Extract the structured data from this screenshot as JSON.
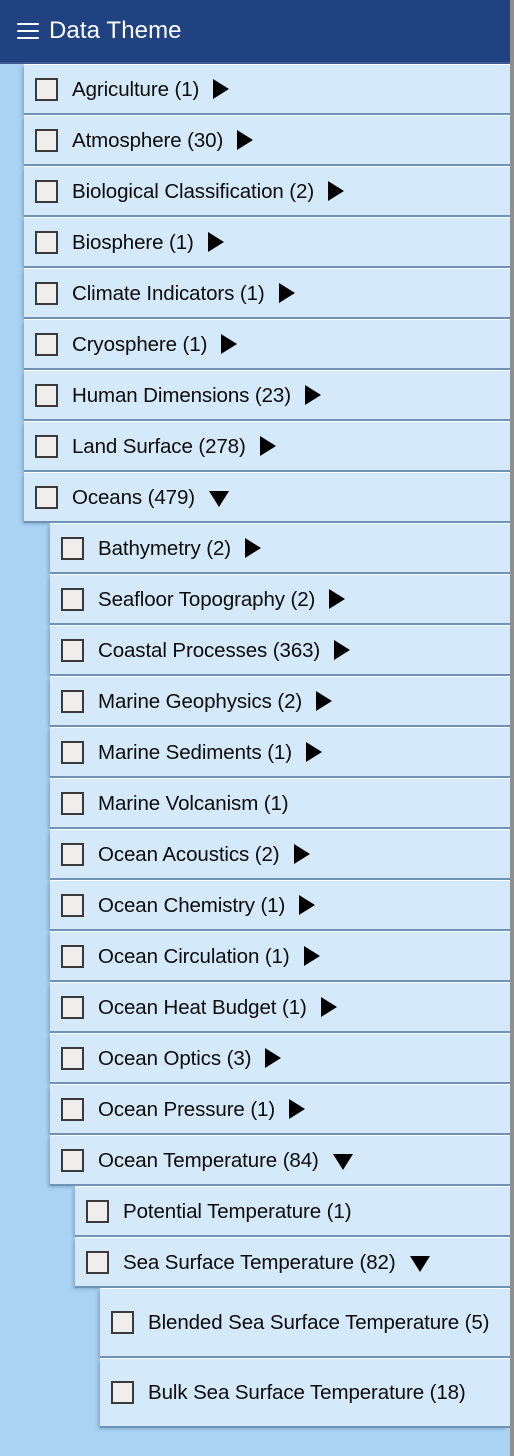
{
  "header": {
    "title": "Data Theme",
    "menu_icon": "hamburger-icon",
    "background_color": "#204281",
    "text_color": "#ffffff"
  },
  "colors": {
    "panel_background": "#a9d2f3",
    "row_background": "#d4e9fa",
    "row_divider": "#6f93b4",
    "checkbox_border": "#3a3a3a",
    "checkbox_fill": "#efeeec",
    "arrow": "#000000"
  },
  "tree": {
    "items": [
      {
        "label": "Agriculture (1)",
        "name": "Agriculture",
        "count": 1,
        "level": 0,
        "arrow": "collapsed",
        "checked": false
      },
      {
        "label": "Atmosphere (30)",
        "name": "Atmosphere",
        "count": 30,
        "level": 0,
        "arrow": "collapsed",
        "checked": false
      },
      {
        "label": "Biological Classification (2)",
        "name": "Biological Classification",
        "count": 2,
        "level": 0,
        "arrow": "collapsed",
        "checked": false
      },
      {
        "label": "Biosphere (1)",
        "name": "Biosphere",
        "count": 1,
        "level": 0,
        "arrow": "collapsed",
        "checked": false
      },
      {
        "label": "Climate Indicators (1)",
        "name": "Climate Indicators",
        "count": 1,
        "level": 0,
        "arrow": "collapsed",
        "checked": false
      },
      {
        "label": "Cryosphere (1)",
        "name": "Cryosphere",
        "count": 1,
        "level": 0,
        "arrow": "collapsed",
        "checked": false
      },
      {
        "label": "Human Dimensions (23)",
        "name": "Human Dimensions",
        "count": 23,
        "level": 0,
        "arrow": "collapsed",
        "checked": false
      },
      {
        "label": "Land Surface (278)",
        "name": "Land Surface",
        "count": 278,
        "level": 0,
        "arrow": "collapsed",
        "checked": false
      },
      {
        "label": "Oceans (479)",
        "name": "Oceans",
        "count": 479,
        "level": 0,
        "arrow": "expanded",
        "checked": false
      },
      {
        "label": "Bathymetry (2)",
        "name": "Bathymetry",
        "count": 2,
        "level": 1,
        "arrow": "collapsed",
        "checked": false
      },
      {
        "label": "Seafloor Topography (2)",
        "name": "Seafloor Topography",
        "count": 2,
        "level": 1,
        "arrow": "collapsed",
        "checked": false
      },
      {
        "label": "Coastal Processes (363)",
        "name": "Coastal Processes",
        "count": 363,
        "level": 1,
        "arrow": "collapsed",
        "checked": false
      },
      {
        "label": "Marine Geophysics (2)",
        "name": "Marine Geophysics",
        "count": 2,
        "level": 1,
        "arrow": "collapsed",
        "checked": false
      },
      {
        "label": "Marine Sediments (1)",
        "name": "Marine Sediments",
        "count": 1,
        "level": 1,
        "arrow": "collapsed",
        "checked": false
      },
      {
        "label": "Marine Volcanism (1)",
        "name": "Marine Volcanism",
        "count": 1,
        "level": 1,
        "arrow": "none",
        "checked": false
      },
      {
        "label": "Ocean Acoustics (2)",
        "name": "Ocean Acoustics",
        "count": 2,
        "level": 1,
        "arrow": "collapsed",
        "checked": false
      },
      {
        "label": "Ocean Chemistry (1)",
        "name": "Ocean Chemistry",
        "count": 1,
        "level": 1,
        "arrow": "collapsed",
        "checked": false
      },
      {
        "label": "Ocean Circulation (1)",
        "name": "Ocean Circulation",
        "count": 1,
        "level": 1,
        "arrow": "collapsed",
        "checked": false
      },
      {
        "label": "Ocean Heat Budget (1)",
        "name": "Ocean Heat Budget",
        "count": 1,
        "level": 1,
        "arrow": "collapsed",
        "checked": false
      },
      {
        "label": "Ocean Optics (3)",
        "name": "Ocean Optics",
        "count": 3,
        "level": 1,
        "arrow": "collapsed",
        "checked": false
      },
      {
        "label": "Ocean Pressure (1)",
        "name": "Ocean Pressure",
        "count": 1,
        "level": 1,
        "arrow": "collapsed",
        "checked": false
      },
      {
        "label": "Ocean Temperature (84)",
        "name": "Ocean Temperature",
        "count": 84,
        "level": 1,
        "arrow": "expanded",
        "checked": false
      },
      {
        "label": "Potential Temperature (1)",
        "name": "Potential Temperature",
        "count": 1,
        "level": 2,
        "arrow": "none",
        "checked": false
      },
      {
        "label": "Sea Surface Temperature (82)",
        "name": "Sea Surface Temperature",
        "count": 82,
        "level": 2,
        "arrow": "expanded",
        "checked": false
      },
      {
        "label": "Blended Sea Surface Temperature (5)",
        "name": "Blended Sea Surface Temperature",
        "count": 5,
        "level": 3,
        "arrow": "none",
        "checked": false,
        "tall": true
      },
      {
        "label": "Bulk Sea Surface Temperature (18)",
        "name": "Bulk Sea Surface Temperature",
        "count": 18,
        "level": 3,
        "arrow": "none",
        "checked": false,
        "tall": true
      }
    ]
  }
}
